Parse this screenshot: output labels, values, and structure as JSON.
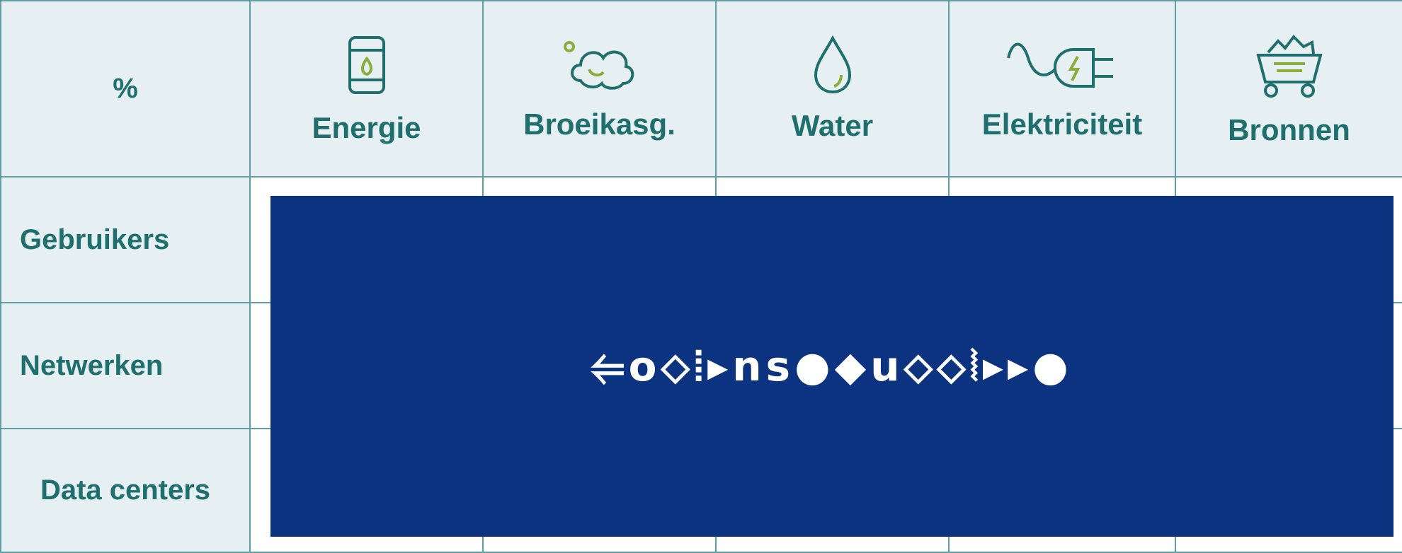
{
  "table": {
    "corner_label": "%",
    "columns": [
      {
        "label": "Energie",
        "icon": "oil-barrel-flame-icon"
      },
      {
        "label": "Broeikasg.",
        "icon": "cloud-icon"
      },
      {
        "label": "Water",
        "icon": "water-drop-icon"
      },
      {
        "label": "Elektriciteit",
        "icon": "electric-plug-icon"
      },
      {
        "label": "Bronnen",
        "icon": "ore-cart-icon"
      }
    ],
    "rows": [
      {
        "label": "Gebruikers"
      },
      {
        "label": "Netwerken"
      },
      {
        "label": "Data centers"
      }
    ]
  },
  "overlay": {
    "text": "⥢o⬦⦙▸ns●◆u⬦⬦⦚▸▸●",
    "background": "#0b3380"
  },
  "colors": {
    "teal": "#1f6f6f",
    "header_bg": "#e6f0f2",
    "grid_line": "#5f9ea2",
    "icon_green": "#8aae3c"
  }
}
